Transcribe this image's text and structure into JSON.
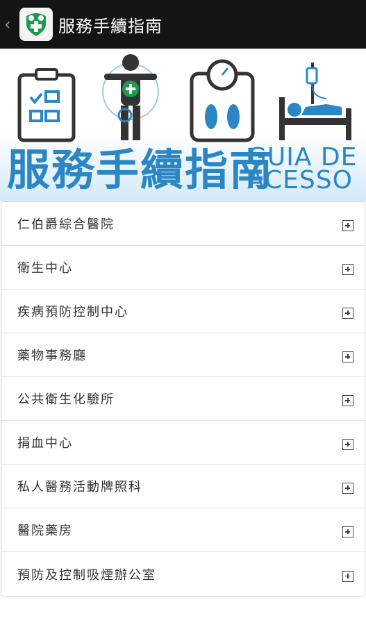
{
  "topbar": {
    "back_icon": "chevron-left-icon",
    "logo_icon": "green-shield-cross-logo",
    "title": "服務手續指南"
  },
  "banner": {
    "title_cn": "服務手續指南",
    "title_pt_line1": "GUIA DE",
    "title_pt_line2": "ACESSO",
    "icons": [
      "clipboard-checklist-icon",
      "patient-body-icon",
      "scale-feet-icon",
      "hospital-bed-icon"
    ],
    "accent_color": "#2b86c5"
  },
  "list": {
    "items": [
      {
        "label": "仁伯爵綜合醫院"
      },
      {
        "label": "衛生中心"
      },
      {
        "label": "疾病預防控制中心"
      },
      {
        "label": "藥物事務廳"
      },
      {
        "label": "公共衛生化驗所"
      },
      {
        "label": "捐血中心"
      },
      {
        "label": "私人醫務活動牌照科"
      },
      {
        "label": "醫院藥房"
      },
      {
        "label": "預防及控制吸煙辦公室"
      }
    ],
    "expand_icon": "plus-square-icon"
  }
}
